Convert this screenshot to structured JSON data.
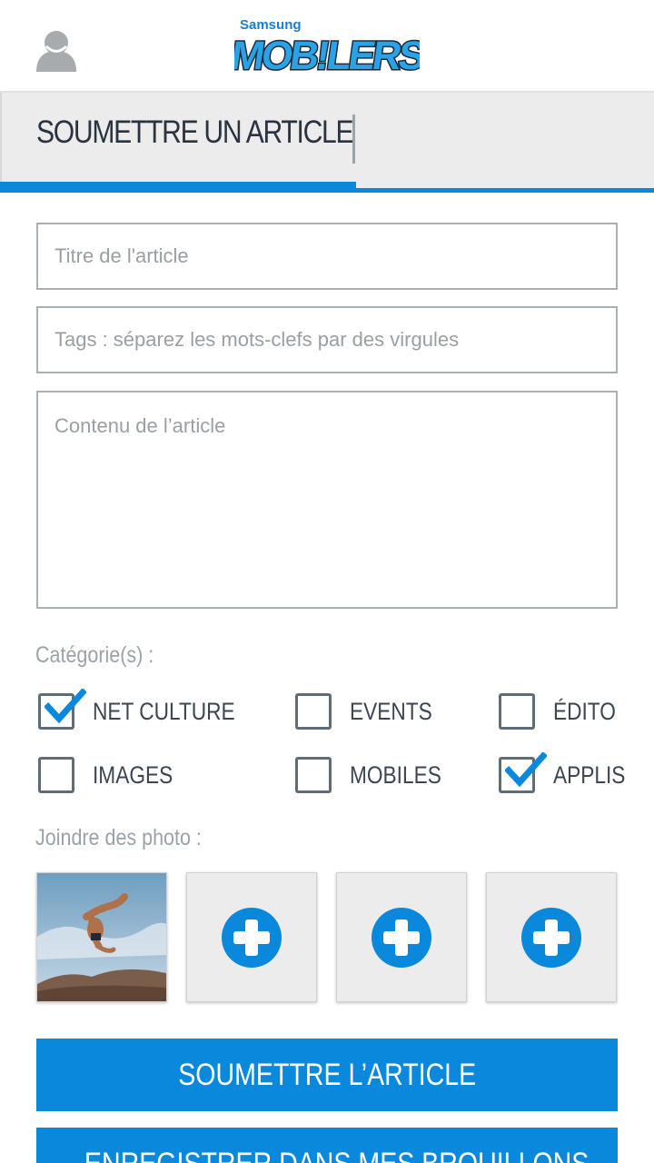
{
  "header": {
    "logo_brand": "Samsung",
    "logo_word": "MOB!LERS"
  },
  "tab": {
    "title": "SOUMETTRE UN ARTICLE"
  },
  "form": {
    "title_placeholder": "Titre de l'article",
    "tags_placeholder": "Tags : séparez les mots-clefs par des virgules",
    "content_placeholder": "Contenu de l’article"
  },
  "categories": {
    "label": "Catégorie(s) :",
    "items": [
      {
        "label": "NET CULTURE",
        "checked": true
      },
      {
        "label": "EVENTS",
        "checked": false
      },
      {
        "label": "ÉDITO",
        "checked": false
      },
      {
        "label": "IMAGES",
        "checked": false
      },
      {
        "label": "MOBILES",
        "checked": false
      },
      {
        "label": "APPLIS",
        "checked": true
      }
    ]
  },
  "photos": {
    "label": "Joindre des photo :",
    "slots": [
      {
        "filled": true,
        "icon": "photo-thumbnail"
      },
      {
        "filled": false,
        "icon": "add-photo-icon"
      },
      {
        "filled": false,
        "icon": "add-photo-icon"
      },
      {
        "filled": false,
        "icon": "add-photo-icon"
      }
    ]
  },
  "buttons": {
    "submit_label": "SOUMETTRE L’ARTICLE",
    "draft_label": "ENREGISTRER DANS MES BROUILLONS"
  },
  "colors": {
    "accent": "#0a88dc",
    "tab_bg": "#ececec",
    "text_dark": "#2a3440",
    "label_grey": "#9aa3a9"
  }
}
